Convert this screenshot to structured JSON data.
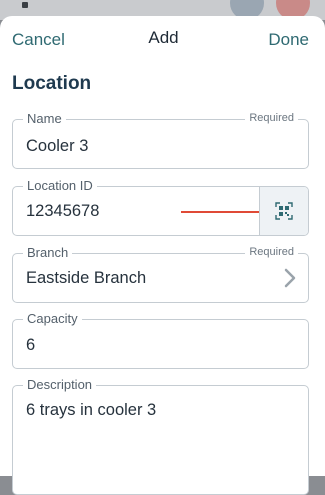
{
  "nav": {
    "cancel": "Cancel",
    "title": "Add",
    "done": "Done"
  },
  "section": {
    "title": "Location"
  },
  "fields": {
    "name": {
      "label": "Name",
      "required": "Required",
      "value": "Cooler 3"
    },
    "location_id": {
      "label": "Location ID",
      "value": "12345678",
      "scan_icon": "qr-scan-icon"
    },
    "branch": {
      "label": "Branch",
      "required": "Required",
      "value": "Eastside Branch"
    },
    "capacity": {
      "label": "Capacity",
      "value": "6"
    },
    "description": {
      "label": "Description",
      "value": "6 trays in cooler 3"
    }
  },
  "colors": {
    "accent": "#2f6a72",
    "annotation_arrow": "#e04a36",
    "border": "#c5ccd2"
  }
}
